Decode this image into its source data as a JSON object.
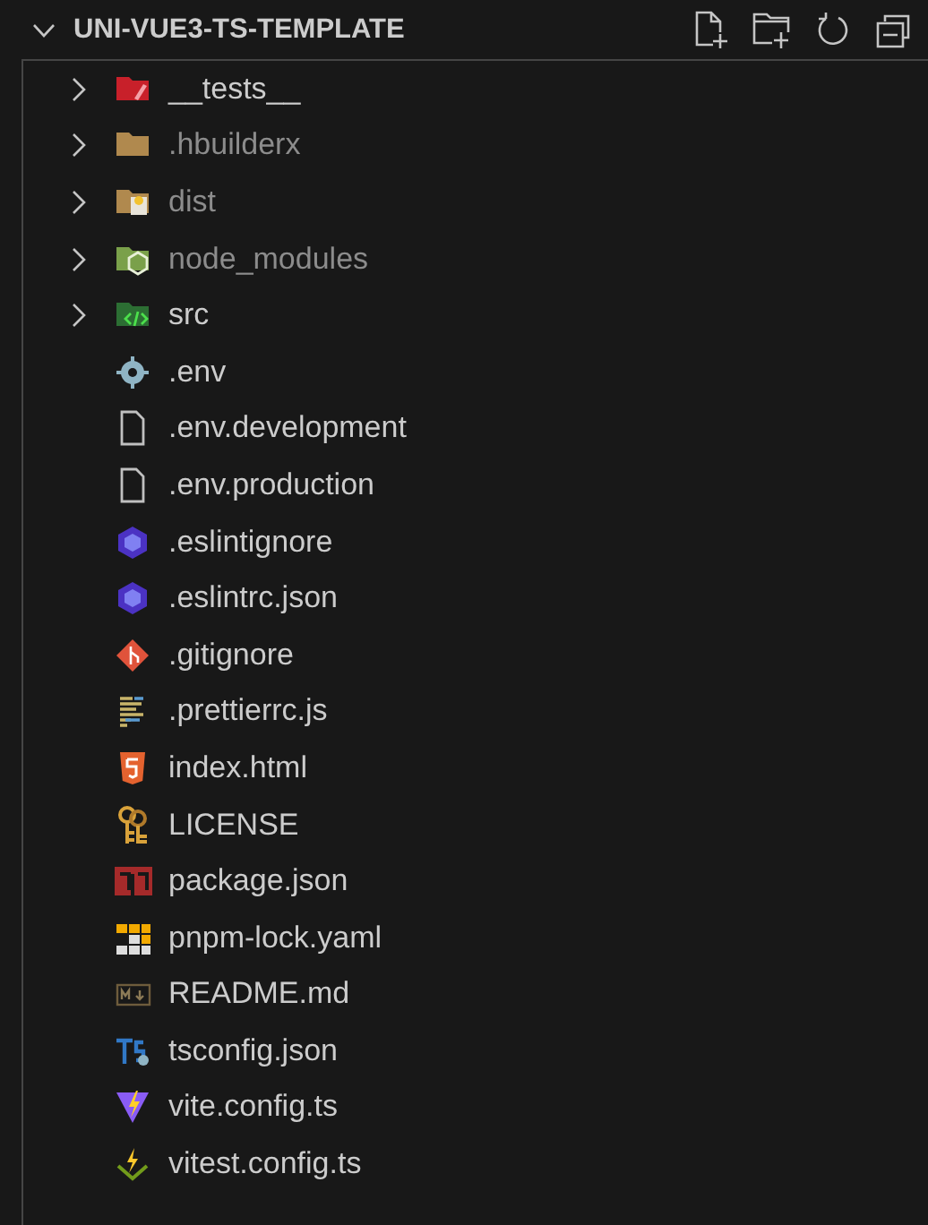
{
  "explorer": {
    "title": "UNI-VUE3-TS-TEMPLATE",
    "expanded": true
  },
  "items": [
    {
      "name": "__tests__",
      "kind": "folder",
      "expanded": false,
      "ignored": false
    },
    {
      "name": ".hbuilderx",
      "kind": "folder",
      "expanded": false,
      "ignored": true
    },
    {
      "name": "dist",
      "kind": "folder",
      "expanded": false,
      "ignored": true
    },
    {
      "name": "node_modules",
      "kind": "folder",
      "expanded": false,
      "ignored": true
    },
    {
      "name": "src",
      "kind": "folder",
      "expanded": false,
      "ignored": false
    },
    {
      "name": ".env",
      "kind": "file",
      "ignored": false
    },
    {
      "name": ".env.development",
      "kind": "file",
      "ignored": false
    },
    {
      "name": ".env.production",
      "kind": "file",
      "ignored": false
    },
    {
      "name": ".eslintignore",
      "kind": "file",
      "ignored": false
    },
    {
      "name": ".eslintrc.json",
      "kind": "file",
      "ignored": false
    },
    {
      "name": ".gitignore",
      "kind": "file",
      "ignored": false
    },
    {
      "name": ".prettierrc.js",
      "kind": "file",
      "ignored": false
    },
    {
      "name": "index.html",
      "kind": "file",
      "ignored": false
    },
    {
      "name": "LICENSE",
      "kind": "file",
      "ignored": false
    },
    {
      "name": "package.json",
      "kind": "file",
      "ignored": false
    },
    {
      "name": "pnpm-lock.yaml",
      "kind": "file",
      "ignored": false
    },
    {
      "name": "README.md",
      "kind": "file",
      "ignored": false
    },
    {
      "name": "tsconfig.json",
      "kind": "file",
      "ignored": false
    },
    {
      "name": "vite.config.ts",
      "kind": "file",
      "ignored": false
    },
    {
      "name": "vitest.config.ts",
      "kind": "file",
      "ignored": false
    }
  ]
}
